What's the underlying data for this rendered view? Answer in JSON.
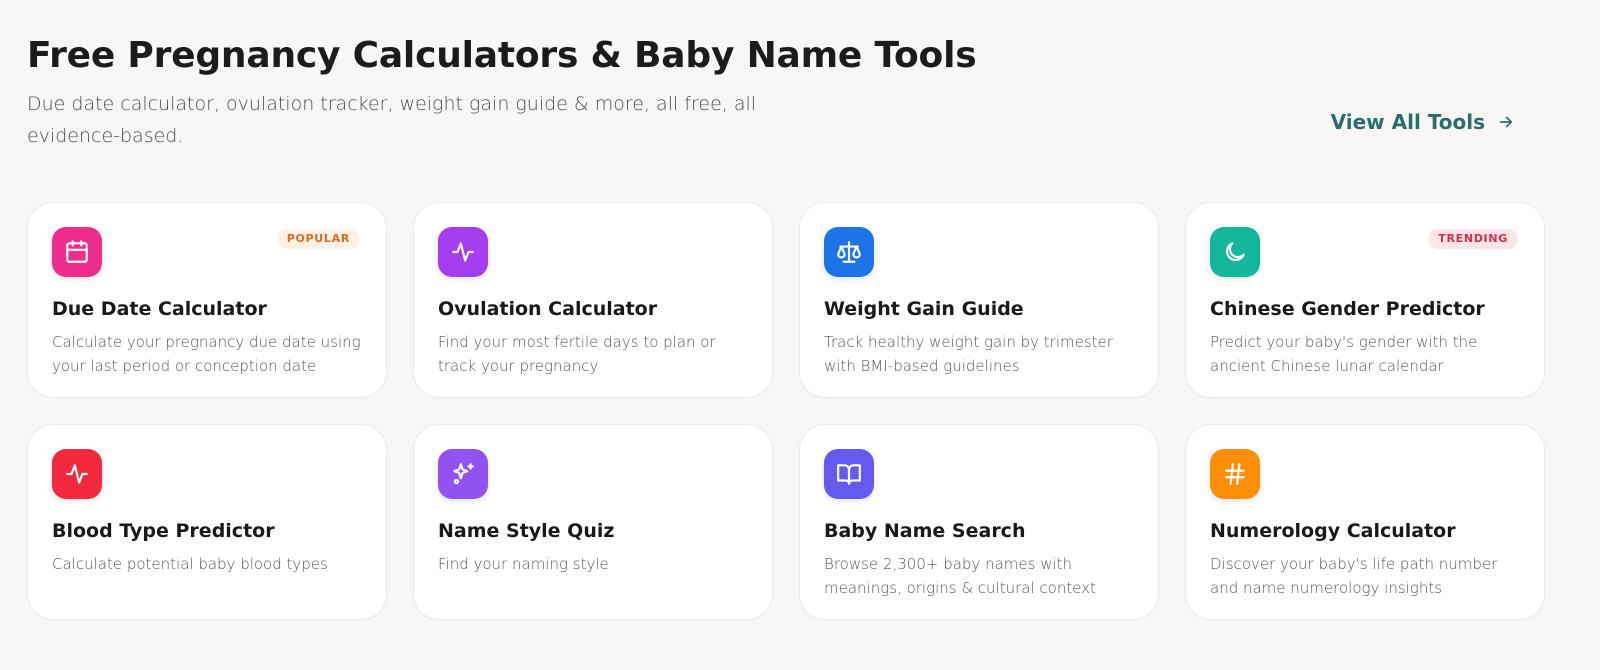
{
  "header": {
    "title": "Free Pregnancy Calculators & Baby Name Tools",
    "subtitle": "Due date calculator, ovulation tracker, weight gain guide & more, all free, all evidence-based.",
    "view_all_label": "View All Tools",
    "accent_color": "#2a6d6d"
  },
  "cards": [
    {
      "title": "Due Date Calculator",
      "description": "Calculate your pregnancy due date using your last period or conception date",
      "icon": "calendar-icon",
      "icon_color": "#ee2d8f",
      "badge": "POPULAR"
    },
    {
      "title": "Ovulation Calculator",
      "description": "Find your most fertile days to plan or track your pregnancy",
      "icon": "activity-icon",
      "icon_color": "#a43df0",
      "badge": ""
    },
    {
      "title": "Weight Gain Guide",
      "description": "Track healthy weight gain by trimester with BMI-based guidelines",
      "icon": "scale-icon",
      "icon_color": "#1f73e8",
      "badge": ""
    },
    {
      "title": "Chinese Gender Predictor",
      "description": "Predict your baby's gender with the ancient Chinese lunar calendar",
      "icon": "moon-icon",
      "icon_color": "#13b79b",
      "badge": "TRENDING"
    },
    {
      "title": "Blood Type Predictor",
      "description": "Calculate potential baby blood types",
      "icon": "pulse-icon",
      "icon_color": "#f2293f",
      "badge": ""
    },
    {
      "title": "Name Style Quiz",
      "description": "Find your naming style",
      "icon": "sparkles-icon",
      "icon_color": "#9152f1",
      "badge": ""
    },
    {
      "title": "Baby Name Search",
      "description": "Browse 2,300+ baby names with meanings, origins & cultural context",
      "icon": "book-icon",
      "icon_color": "#645af0",
      "badge": ""
    },
    {
      "title": "Numerology Calculator",
      "description": "Discover your baby's life path number and name numerology insights",
      "icon": "hash-icon",
      "icon_color": "#fb8f08",
      "badge": ""
    }
  ]
}
